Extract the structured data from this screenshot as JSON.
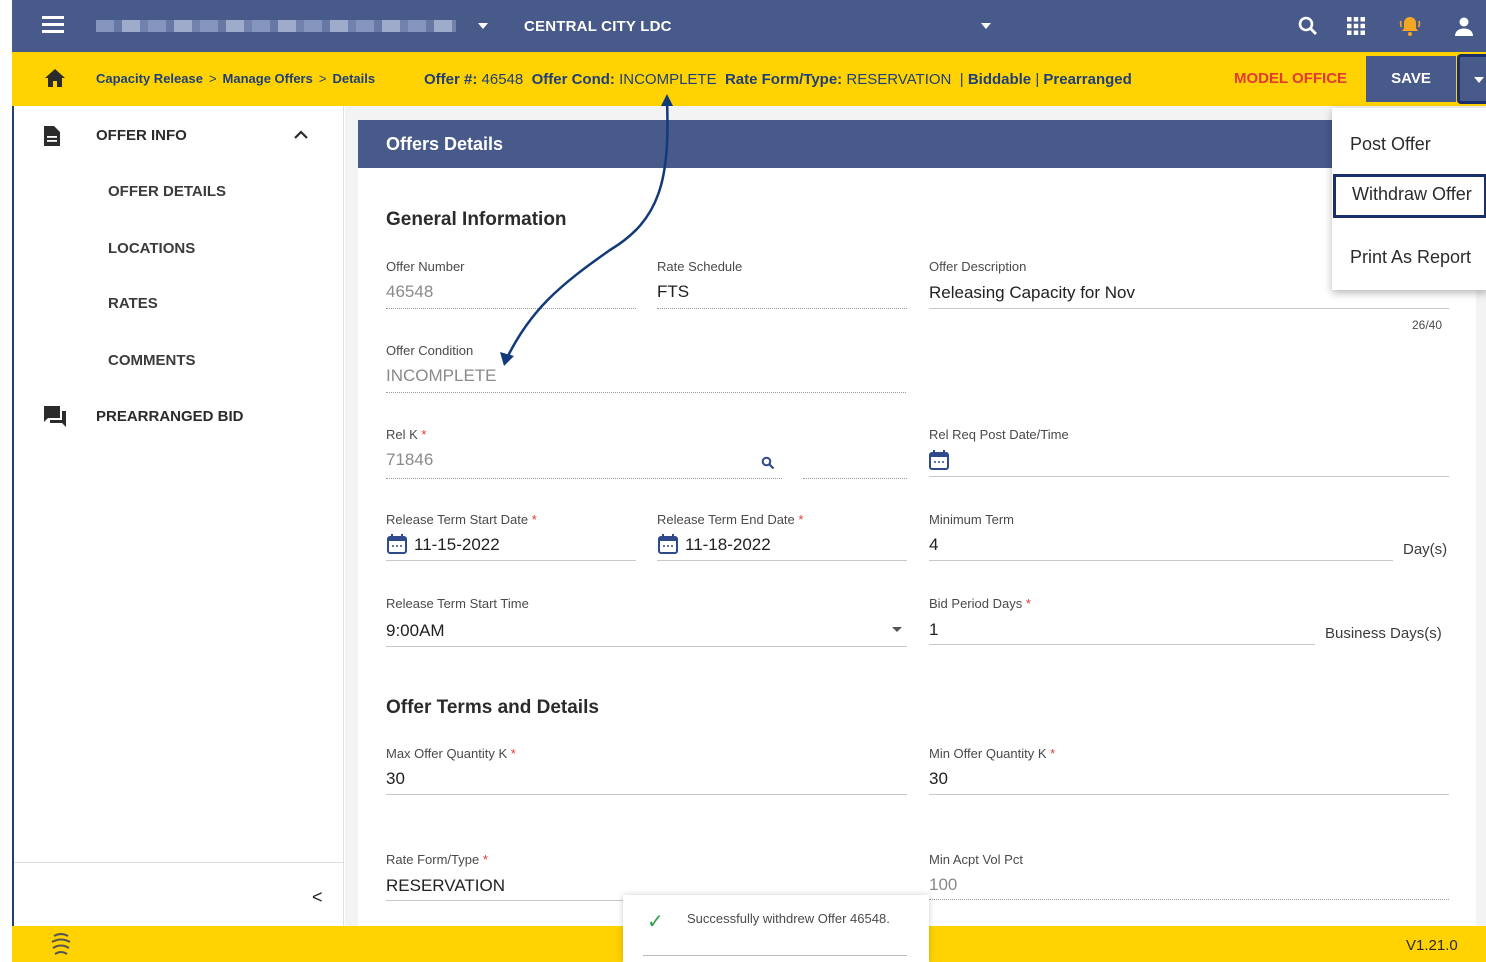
{
  "topbar": {
    "org_selector_caret": "dropdown",
    "ldc_label": "CENTRAL CITY LDC"
  },
  "breadcrumb": {
    "items": [
      "Capacity Release",
      "Manage Offers",
      "Details"
    ],
    "separator": ">"
  },
  "offer_summary": {
    "offer_num_label": "Offer #:",
    "offer_num": "46548",
    "cond_label": "Offer Cond:",
    "cond": "INCOMPLETE",
    "rate_label": "Rate Form/Type:",
    "rate": "RESERVATION",
    "flag1": "Biddable",
    "flag2": "Prearranged",
    "pipe": "|"
  },
  "header_actions": {
    "model_office": "MODEL OFFICE",
    "save_label": "SAVE"
  },
  "sidebar": {
    "section_offer_info": "OFFER INFO",
    "items": [
      "OFFER DETAILS",
      "LOCATIONS",
      "RATES",
      "COMMENTS"
    ],
    "section_prearranged": "PREARRANGED BID",
    "collapse_glyph": "<"
  },
  "card": {
    "title": "Offers Details",
    "general_heading": "General Information",
    "terms_heading": "Offer Terms and Details"
  },
  "fields": {
    "offer_number": {
      "label": "Offer Number",
      "value": "46548"
    },
    "rate_schedule": {
      "label": "Rate Schedule",
      "value": "FTS"
    },
    "offer_description": {
      "label": "Offer Description",
      "value": "Releasing Capacity for Nov",
      "counter": "26/40"
    },
    "offer_condition": {
      "label": "Offer Condition",
      "value": "INCOMPLETE"
    },
    "rel_k": {
      "label": "Rel K",
      "value": "71846",
      "required": "*"
    },
    "rel_req_post": {
      "label": "Rel Req Post Date/Time"
    },
    "term_start_date": {
      "label": "Release Term Start Date",
      "value": "11-15-2022",
      "required": "*"
    },
    "term_end_date": {
      "label": "Release Term End Date",
      "value": "11-18-2022",
      "required": "*"
    },
    "minimum_term": {
      "label": "Minimum Term",
      "value": "4",
      "unit": "Day(s)"
    },
    "term_start_time": {
      "label": "Release Term Start Time",
      "value": "9:00AM"
    },
    "bid_period_days": {
      "label": "Bid Period Days",
      "value": "1",
      "unit": "Business Days(s)",
      "required": "*"
    },
    "max_offer_qty": {
      "label": "Max Offer Quantity K",
      "value": "30",
      "required": "*"
    },
    "min_offer_qty": {
      "label": "Min Offer Quantity K",
      "value": "30",
      "required": "*"
    },
    "rate_form_type": {
      "label": "Rate Form/Type",
      "value": "RESERVATION",
      "required": "*"
    },
    "min_acpt_vol_pct": {
      "label": "Min Acpt Vol Pct",
      "value": "100"
    }
  },
  "menu": {
    "items": [
      "Post Offer",
      "Withdraw Offer",
      "Print As Report"
    ],
    "selected": "Withdraw Offer"
  },
  "snackbar": {
    "message": "Successfully withdrew Offer 46548."
  },
  "footer": {
    "version": "V1.21.0"
  },
  "colors": {
    "nav_blue": "#475a8a",
    "brand_yellow": "#ffd200",
    "alert_red": "#e53935",
    "success_green": "#2e9f46"
  }
}
